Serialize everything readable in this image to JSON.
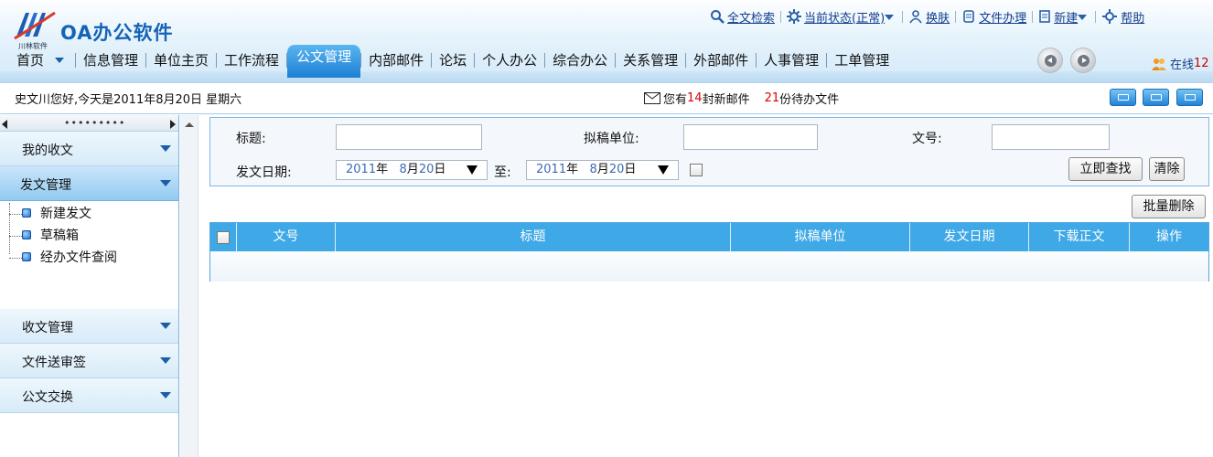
{
  "app": {
    "logo_text": "OA办公软件",
    "logo_sub": "川林软件",
    "brand_color": "#1563b8"
  },
  "toplinks": [
    {
      "label": "全文检索",
      "icon": "magnifier-icon"
    },
    {
      "label": "当前状态(正常)",
      "icon": "gear-icon"
    },
    {
      "label": "换肤",
      "icon": "user-icon"
    },
    {
      "label": "文件办理",
      "icon": "document-icon"
    },
    {
      "label": "新建",
      "icon": "new-doc-icon"
    },
    {
      "label": "帮助",
      "icon": "help-gear-icon"
    }
  ],
  "nav": {
    "items": [
      "首页",
      "信息管理",
      "单位主页",
      "工作流程",
      "公文管理",
      "内部邮件",
      "论坛",
      "个人办公",
      "综合办公",
      "关系管理",
      "外部邮件",
      "人事管理",
      "工单管理"
    ],
    "active": "公文管理"
  },
  "online": {
    "label": "在线",
    "count": "12"
  },
  "infobar": {
    "greeting": "史文川您好,今天是2011年8月20日  星期六",
    "mail_prefix": "您有",
    "mail_count": "14",
    "mail_suffix": "封新邮件",
    "todo_count": "21",
    "todo_suffix": "份待办文件"
  },
  "sidebar": {
    "sections": [
      {
        "title": "我的收文"
      },
      {
        "title": "发文管理"
      },
      {
        "title": "收文管理"
      },
      {
        "title": "文件送审签"
      },
      {
        "title": "公文交换"
      }
    ],
    "subitems": [
      "新建发文",
      "草稿箱",
      "经办文件查阅"
    ],
    "active_section": "发文管理"
  },
  "search": {
    "title_label": "标题:",
    "unit_label": "拟稿单位:",
    "docno_label": "文号:",
    "date_label": "发文日期:",
    "to_label": "至:",
    "date_from": {
      "year": "2011",
      "year_unit": "年",
      "month": "8",
      "month_unit": "月",
      "day": "20",
      "day_unit": "日"
    },
    "date_to": {
      "year": "2011",
      "year_unit": "年",
      "month": "8",
      "month_unit": "月",
      "day": "20",
      "day_unit": "日"
    },
    "search_button": "立即查找",
    "clear_button": "清除"
  },
  "toolbar": {
    "batch_delete": "批量删除"
  },
  "table": {
    "columns": [
      "文号",
      "标题",
      "拟稿单位",
      "发文日期",
      "下载正文",
      "操作"
    ],
    "header_color": "#3fa8e6"
  }
}
